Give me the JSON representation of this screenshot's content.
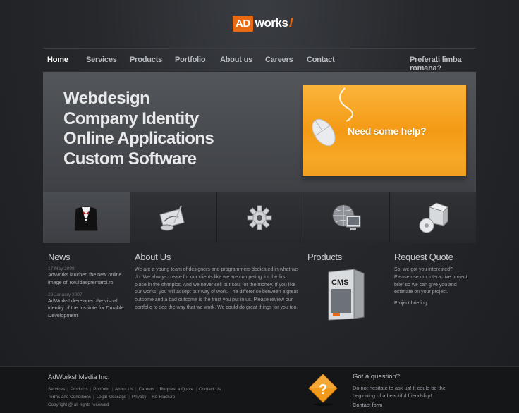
{
  "logo": {
    "ad": "AD",
    "works": "works",
    "bang": "!"
  },
  "nav": {
    "items": [
      {
        "label": "Home",
        "active": true
      },
      {
        "label": "Services"
      },
      {
        "label": "Products"
      },
      {
        "label": "Portfolio"
      },
      {
        "label": "About us"
      },
      {
        "label": "Careers"
      },
      {
        "label": "Contact"
      }
    ],
    "language": "Preferati limba romana?"
  },
  "banner": {
    "lines": [
      "Webdesign",
      "Company Identity",
      "Online Applications",
      "Custom Software"
    ],
    "help_text": "Need some help?"
  },
  "strip": {
    "icons": [
      "tuxedo-icon",
      "design-tools-icon",
      "gear-icon",
      "computer-globe-icon",
      "software-box-icon"
    ]
  },
  "news": {
    "title": "News",
    "items": [
      {
        "date": "17 May 2008",
        "text": "AdWorks lauched the new online image of Totuldespremarci.ro"
      },
      {
        "date": "29 January 2007",
        "text": "AdWorks! developed the visual identity of the Institute for Durable Development"
      }
    ]
  },
  "about": {
    "title": "About Us",
    "text": "We are a young team of designers and programmers dedicated in what we do. We always create for our clients like we are competing for the first place in the olympics. And we never sell our soul for the money. If you like our works, you will accept our way of work. The difference between a great outcome and a bad outcome is the trust you put in us. Please review our portfolio to see the way that we work. We could do great things for you too."
  },
  "products": {
    "title": "Products",
    "box_label": "CMS"
  },
  "quote": {
    "title": "Request Quote",
    "text": "So, we got you interested? Please use our interactive project brief so we can give you and estimate on your project.",
    "link": "Project briefing"
  },
  "footer": {
    "company": "AdWorks! Media Inc.",
    "links_row1": [
      "Services",
      "Products",
      "Portfolio",
      "About Us",
      "Careers",
      "Request a Quote",
      "Contact Us"
    ],
    "links_row2": [
      "Terms and Conditions",
      "Legal Message",
      "Privacy",
      "Ro-Flash.ro"
    ],
    "copyright": "Copyright @ all rights reserved",
    "question_title": "Got a question?",
    "question_text": "Do not hesitate to ask us! It could be the beginning of a beautiful friendship!",
    "contact_link": "Contact form",
    "question_icon": "question-mark-icon"
  },
  "colors": {
    "accent": "#e56a13",
    "help_bg": "#f49a15",
    "background": "#26282c"
  }
}
